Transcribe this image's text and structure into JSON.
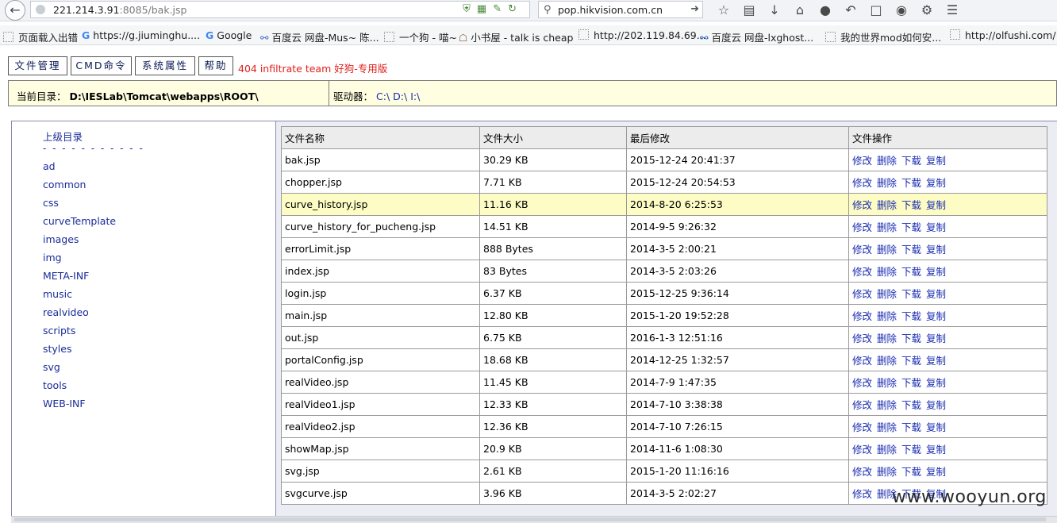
{
  "browser": {
    "url_host": "221.214.3.91",
    "url_path": ":8085/bak.jsp",
    "search_value": "pop.hikvision.com.cn",
    "bookmarks": [
      "页面载入出错",
      "https://g.jiuminghu....",
      "Google",
      "百度云 网盘-Mus~ 陈...",
      "一个狗 - 喵~",
      "小书屋 - talk is cheap",
      "http://202.119.84.69....",
      "百度云 网盘-lxghost...",
      "我的世界mod如何安...",
      "http://olfushi.com/"
    ]
  },
  "menu": {
    "items": [
      "文件管理",
      "CMD命令",
      "系统属性",
      "帮助"
    ],
    "team": "404 infiltrate team 好狗-专用版"
  },
  "pathbar": {
    "current_label": "当前目录：",
    "current_path": "D:\\IESLab\\Tomcat\\webapps\\ROOT\\",
    "drives_label": "驱动器：",
    "drives": [
      "C:\\",
      "D:\\",
      "I:\\"
    ]
  },
  "sidebar": {
    "parent": "上级目录",
    "dashes": "- - - - - - - - - - -",
    "dirs": [
      "ad",
      "common",
      "css",
      "curveTemplate",
      "images",
      "img",
      "META-INF",
      "music",
      "realvideo",
      "scripts",
      "styles",
      "svg",
      "tools",
      "WEB-INF"
    ]
  },
  "table": {
    "headers": [
      "文件名称",
      "文件大小",
      "最后修改",
      "文件操作"
    ],
    "ops": [
      "修改",
      "删除",
      "下载",
      "复制"
    ],
    "rows": [
      {
        "name": "bak.jsp",
        "size": "30.29 KB",
        "modified": "2015-12-24 20:41:37"
      },
      {
        "name": "chopper.jsp",
        "size": "7.71 KB",
        "modified": "2015-12-24 20:54:53"
      },
      {
        "name": "curve_history.jsp",
        "size": "11.16 KB",
        "modified": "2014-8-20 6:25:53"
      },
      {
        "name": "curve_history_for_pucheng.jsp",
        "size": "14.51 KB",
        "modified": "2014-9-5 9:26:32"
      },
      {
        "name": "errorLimit.jsp",
        "size": "888 Bytes",
        "modified": "2014-3-5 2:00:21"
      },
      {
        "name": "index.jsp",
        "size": "83 Bytes",
        "modified": "2014-3-5 2:03:26"
      },
      {
        "name": "login.jsp",
        "size": "6.37 KB",
        "modified": "2015-12-25 9:36:14"
      },
      {
        "name": "main.jsp",
        "size": "12.80 KB",
        "modified": "2015-1-20 19:52:28"
      },
      {
        "name": "out.jsp",
        "size": "6.75 KB",
        "modified": "2016-1-3 12:51:16"
      },
      {
        "name": "portalConfig.jsp",
        "size": "18.68 KB",
        "modified": "2014-12-25 1:32:57"
      },
      {
        "name": "realVideo.jsp",
        "size": "11.45 KB",
        "modified": "2014-7-9 1:47:35"
      },
      {
        "name": "realVideo1.jsp",
        "size": "12.33 KB",
        "modified": "2014-7-10 3:38:38"
      },
      {
        "name": "realVideo2.jsp",
        "size": "12.36 KB",
        "modified": "2014-7-10 7:26:15"
      },
      {
        "name": "showMap.jsp",
        "size": "20.9 KB",
        "modified": "2014-11-6 1:08:30"
      },
      {
        "name": "svg.jsp",
        "size": "2.61 KB",
        "modified": "2015-1-20 11:16:16"
      },
      {
        "name": "svgcurve.jsp",
        "size": "3.96 KB",
        "modified": "2014-3-5 2:02:27"
      }
    ],
    "highlight_row": 2
  },
  "watermark": "www.wooyun.org"
}
